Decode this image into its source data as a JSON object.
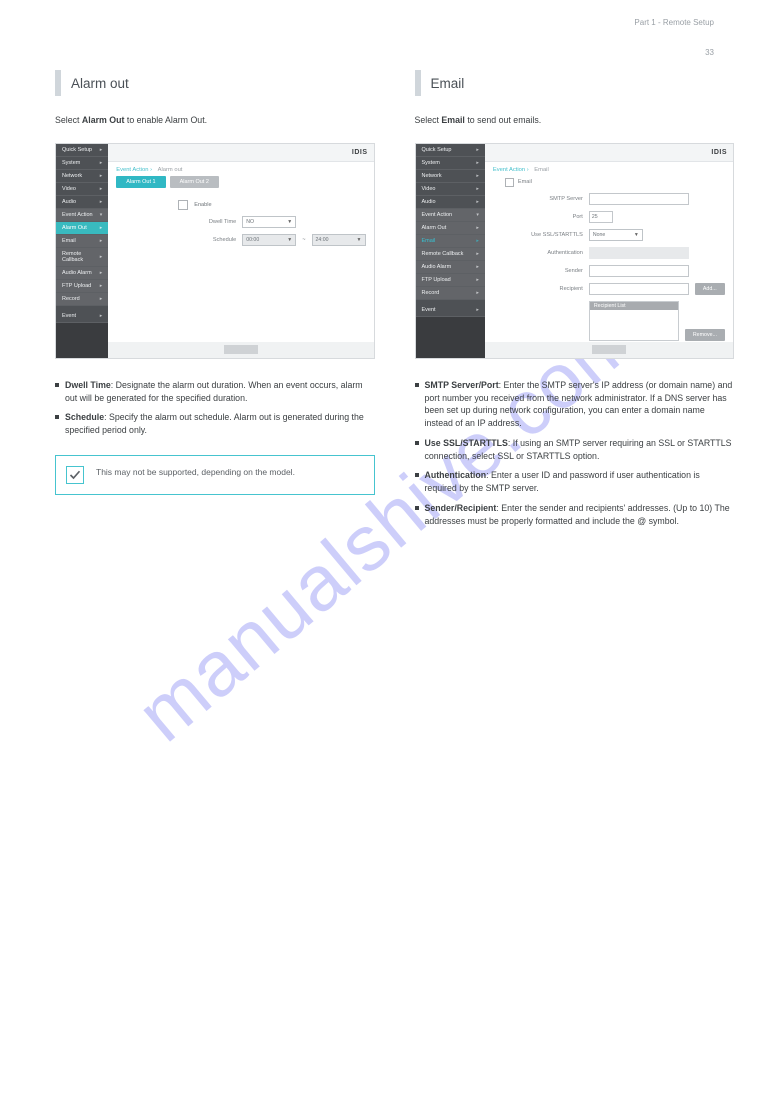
{
  "page_header": "Part 1 - Remote Setup",
  "page_number": "33",
  "watermark": "manualshive.com",
  "left": {
    "section_title": "Alarm out",
    "intro": "Select Alarm Out to enable Alarm Out.",
    "screenshot": {
      "logo": "IDIS",
      "breadcrumb1": "Event Action",
      "breadcrumb2": "Alarm out",
      "tabs": {
        "active": "Alarm Out 1",
        "other": "Alarm Out 2"
      },
      "rows": {
        "enable_label": "Enable",
        "dwell_label": "Dwell Time",
        "dwell_value": "NO",
        "schedule_label": "Schedule",
        "schedule_from": "00:00",
        "schedule_sep": "~",
        "schedule_to": "24:00"
      },
      "sidebar": {
        "items": [
          "Quick Setup",
          "System",
          "Network",
          "Video",
          "Audio",
          "Event Action",
          "Alarm Out",
          "Email",
          "Remote Callback",
          "Audio Alarm",
          "FTP Upload",
          "Record",
          "Event"
        ]
      }
    },
    "bullets": {
      "dwell": {
        "label": "Dwell Time",
        "text": ": Designate the alarm out duration. When an event occurs, alarm out will be generated for the specified duration."
      },
      "schedule": {
        "label": "Schedule",
        "text": ": Specify the alarm out schedule. Alarm out is generated during the specified period only."
      }
    },
    "tip": "This may not be supported, depending on the model."
  },
  "right": {
    "section_title": "Email",
    "intro": "Select Email to send out emails.",
    "screenshot": {
      "logo": "IDIS",
      "breadcrumb1": "Event Action",
      "breadcrumb2": "Email",
      "enable": "Email",
      "rows": {
        "smtp_label": "SMTP Server",
        "port_label": "Port",
        "port_value": "25",
        "ssl_label": "Use SSL/STARTTLS",
        "ssl_value": "None",
        "auth_label": "Authentication",
        "sender_label": "Sender",
        "recipient_label": "Recipient",
        "recipient_list_header": "Recipient List"
      },
      "buttons": {
        "add": "Add...",
        "remove": "Remove..."
      },
      "sidebar": {
        "items": [
          "Quick Setup",
          "System",
          "Network",
          "Video",
          "Audio",
          "Event Action",
          "Alarm Out",
          "Email",
          "Remote Callback",
          "Audio Alarm",
          "FTP Upload",
          "Record",
          "Event"
        ]
      }
    },
    "bullets": {
      "smtp": {
        "label": "SMTP Server/Port",
        "text": ": Enter the SMTP server's IP address (or domain name) and port number you received from the network administrator. If a DNS server has been set up during network configuration, you can enter a domain name instead of an IP address."
      },
      "ssl": {
        "label": "Use SSL/STARTTLS",
        "text": ": If using an SMTP server requiring an SSL or STARTTLS connection, select SSL or STARTTLS option."
      },
      "auth": {
        "label": "Authentication",
        "text": ": Enter a user ID and password if user authentication is required by the SMTP server."
      },
      "sender": {
        "label": "Sender/Recipient",
        "text": ": Enter the sender and recipients' addresses. (Up to 10) The addresses must be properly formatted and include the @ symbol."
      }
    }
  }
}
